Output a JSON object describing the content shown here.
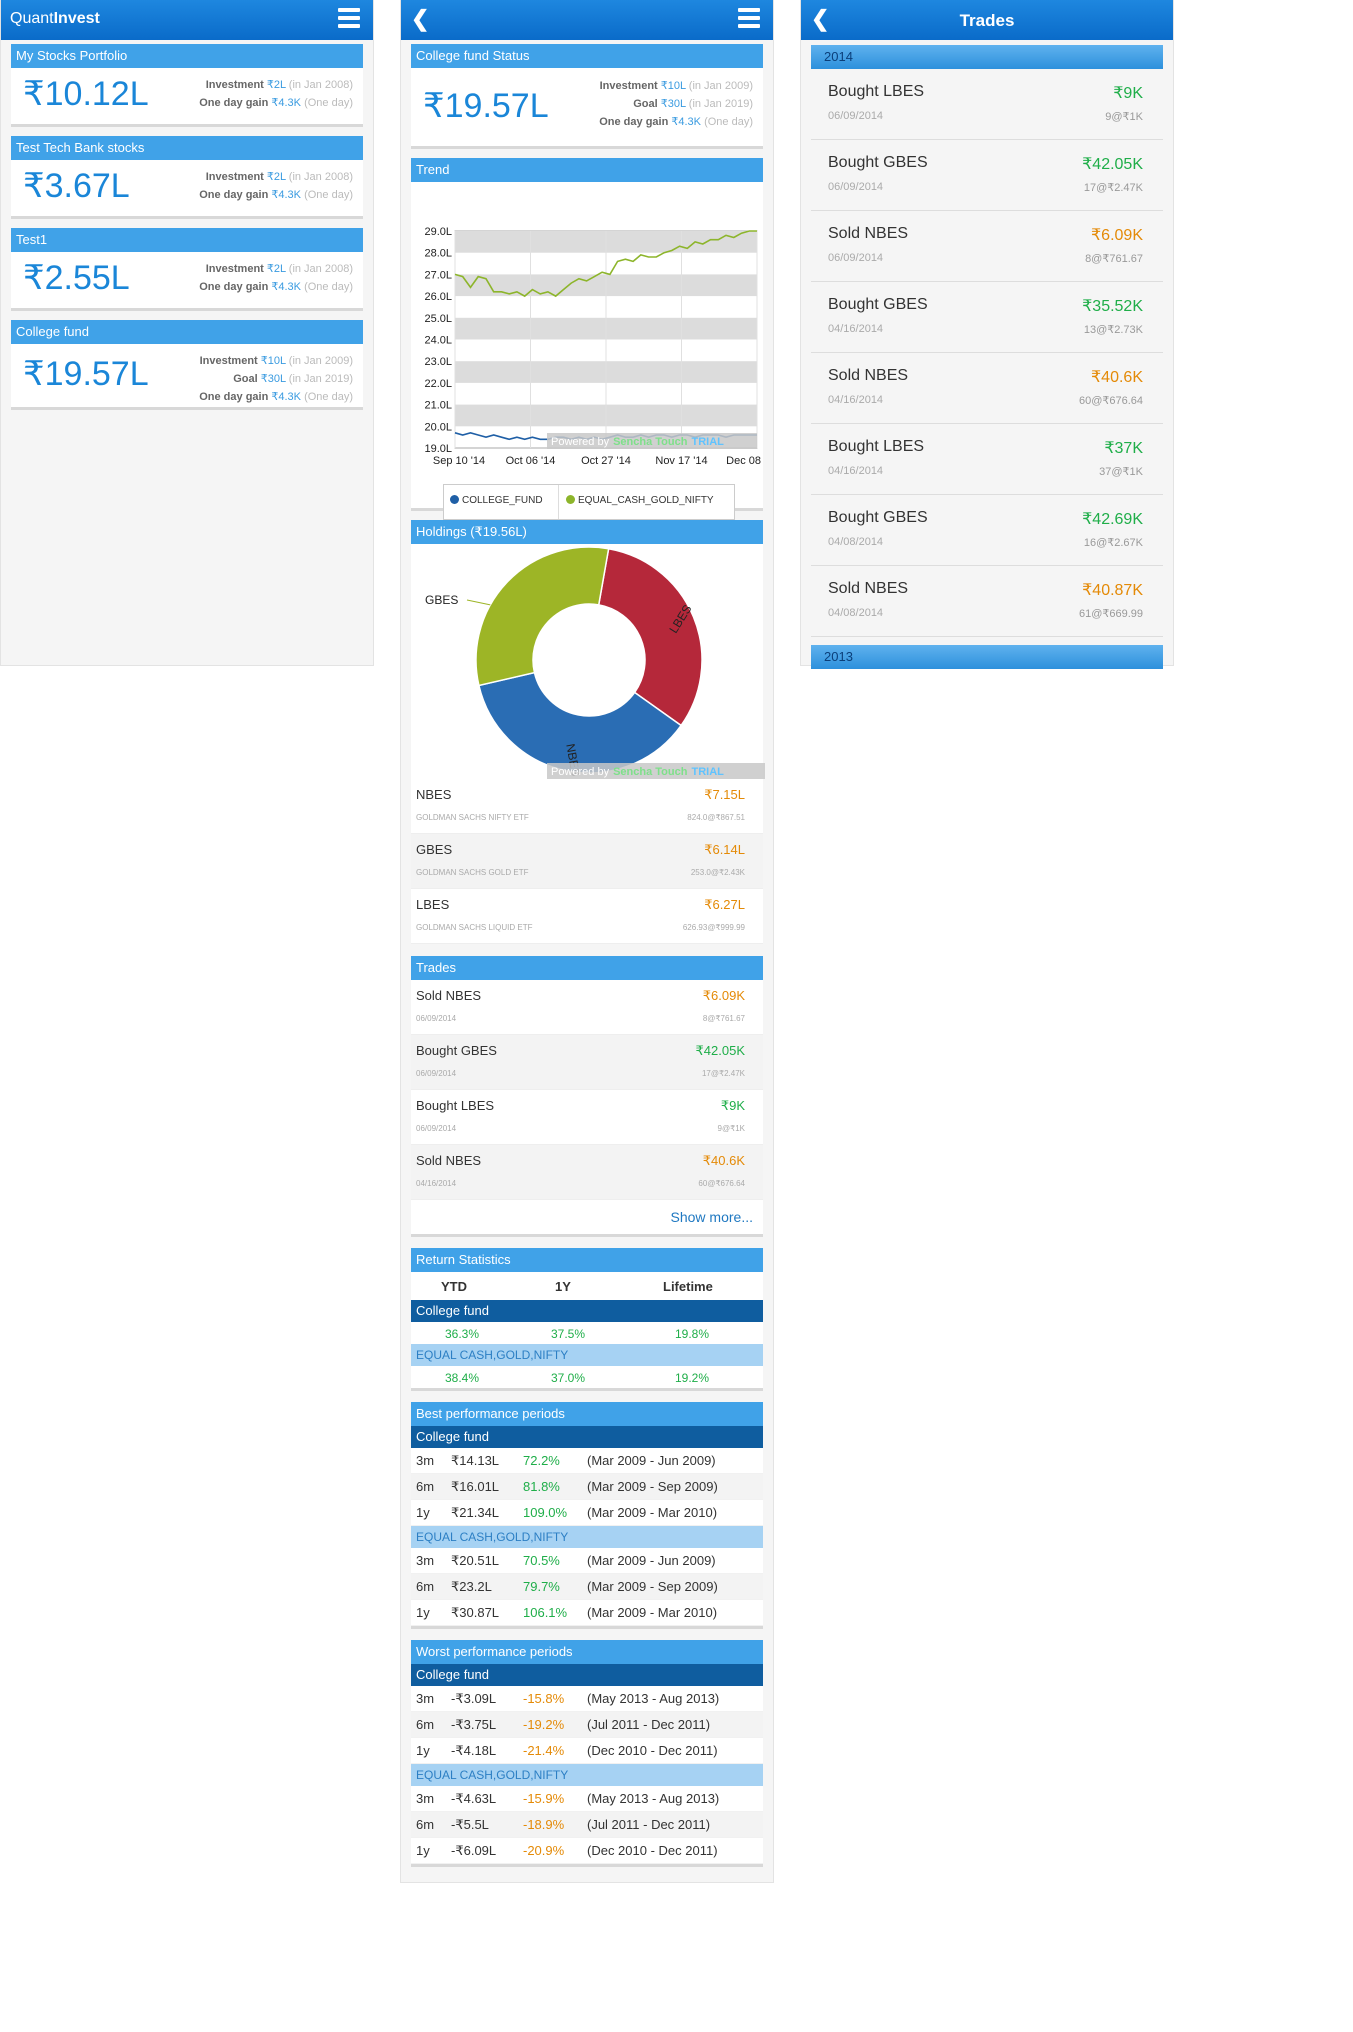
{
  "screen1": {
    "brand_plain": "Quant",
    "brand_bold": "Invest",
    "cards": [
      {
        "title": "My Stocks Portfolio",
        "value": "₹10.12L",
        "rows": [
          {
            "label": "Investment",
            "value": "₹2L",
            "note": "(in Jan 2008)"
          },
          {
            "label": "One day gain",
            "value": "₹4.3K",
            "note": "(One day)"
          }
        ]
      },
      {
        "title": "Test Tech Bank stocks",
        "value": "₹3.67L",
        "rows": [
          {
            "label": "Investment",
            "value": "₹2L",
            "note": "(in Jan 2008)"
          },
          {
            "label": "One day gain",
            "value": "₹4.3K",
            "note": "(One day)"
          }
        ]
      },
      {
        "title": "Test1",
        "value": "₹2.55L",
        "rows": [
          {
            "label": "Investment",
            "value": "₹2L",
            "note": "(in Jan 2008)"
          },
          {
            "label": "One day gain",
            "value": "₹4.3K",
            "note": "(One day)"
          }
        ]
      },
      {
        "title": "College fund",
        "value": "₹19.57L",
        "rows": [
          {
            "label": "Investment",
            "value": "₹10L",
            "note": "(in Jan 2009)"
          },
          {
            "label": "Goal",
            "value": "₹30L",
            "note": "(in Jan 2019)"
          },
          {
            "label": "One day gain",
            "value": "₹4.3K",
            "note": "(One day)"
          }
        ]
      }
    ]
  },
  "screen2": {
    "status": {
      "title": "College fund Status",
      "value": "₹19.57L",
      "rows": [
        {
          "label": "Investment",
          "value": "₹10L",
          "note": "(in Jan 2009)"
        },
        {
          "label": "Goal",
          "value": "₹30L",
          "note": "(in Jan 2019)"
        },
        {
          "label": "One day gain",
          "value": "₹4.3K",
          "note": "(One day)"
        }
      ]
    },
    "trend_title": "Trend",
    "powered_by": "Powered by",
    "sencha": "Sencha Touch",
    "trial": "TRIAL",
    "holdings_title": "Holdings (₹19.56L)",
    "holdings": [
      {
        "name": "NBES",
        "sub": "GOLDMAN SACHS NIFTY ETF",
        "amount": "₹7.15L",
        "qty": "824.0@₹867.51"
      },
      {
        "name": "GBES",
        "sub": "GOLDMAN SACHS GOLD ETF",
        "amount": "₹6.14L",
        "qty": "253.0@₹2.43K"
      },
      {
        "name": "LBES",
        "sub": "GOLDMAN SACHS LIQUID ETF",
        "amount": "₹6.27L",
        "qty": "626.93@₹999.99"
      }
    ],
    "trades_title": "Trades",
    "trades": [
      {
        "name": "Sold NBES",
        "date": "06/09/2014",
        "amount": "₹6.09K",
        "qty": "8@₹761.67",
        "kind": "orange"
      },
      {
        "name": "Bought GBES",
        "date": "06/09/2014",
        "amount": "₹42.05K",
        "qty": "17@₹2.47K",
        "kind": "green"
      },
      {
        "name": "Bought LBES",
        "date": "06/09/2014",
        "amount": "₹9K",
        "qty": "9@₹1K",
        "kind": "green"
      },
      {
        "name": "Sold NBES",
        "date": "04/16/2014",
        "amount": "₹40.6K",
        "qty": "60@₹676.64",
        "kind": "orange"
      }
    ],
    "show_more": "Show more...",
    "return_stats": {
      "title": "Return Statistics",
      "cols": [
        "YTD",
        "1Y",
        "Lifetime"
      ],
      "groups": [
        {
          "name": "College fund",
          "values": [
            "36.3%",
            "37.5%",
            "19.8%"
          ]
        },
        {
          "name": "EQUAL CASH,GOLD,NIFTY",
          "values": [
            "38.4%",
            "37.0%",
            "19.2%"
          ]
        }
      ]
    },
    "best": {
      "title": "Best performance periods",
      "groups": [
        {
          "name": "College fund",
          "rows": [
            {
              "p": "3m",
              "v": "₹14.13L",
              "pct": "72.2%",
              "range": "(Mar 2009 - Jun 2009)"
            },
            {
              "p": "6m",
              "v": "₹16.01L",
              "pct": "81.8%",
              "range": "(Mar 2009 - Sep 2009)"
            },
            {
              "p": "1y",
              "v": "₹21.34L",
              "pct": "109.0%",
              "range": "(Mar 2009 - Mar 2010)"
            }
          ]
        },
        {
          "name": "EQUAL CASH,GOLD,NIFTY",
          "rows": [
            {
              "p": "3m",
              "v": "₹20.51L",
              "pct": "70.5%",
              "range": "(Mar 2009 - Jun 2009)"
            },
            {
              "p": "6m",
              "v": "₹23.2L",
              "pct": "79.7%",
              "range": "(Mar 2009 - Sep 2009)"
            },
            {
              "p": "1y",
              "v": "₹30.87L",
              "pct": "106.1%",
              "range": "(Mar 2009 - Mar 2010)"
            }
          ]
        }
      ]
    },
    "worst": {
      "title": "Worst performance periods",
      "groups": [
        {
          "name": "College fund",
          "rows": [
            {
              "p": "3m",
              "v": "-₹3.09L",
              "pct": "-15.8%",
              "range": "(May 2013 - Aug 2013)"
            },
            {
              "p": "6m",
              "v": "-₹3.75L",
              "pct": "-19.2%",
              "range": "(Jul 2011 - Dec 2011)"
            },
            {
              "p": "1y",
              "v": "-₹4.18L",
              "pct": "-21.4%",
              "range": "(Dec 2010 - Dec 2011)"
            }
          ]
        },
        {
          "name": "EQUAL CASH,GOLD,NIFTY",
          "rows": [
            {
              "p": "3m",
              "v": "-₹4.63L",
              "pct": "-15.9%",
              "range": "(May 2013 - Aug 2013)"
            },
            {
              "p": "6m",
              "v": "-₹5.5L",
              "pct": "-18.9%",
              "range": "(Jul 2011 - Dec 2011)"
            },
            {
              "p": "1y",
              "v": "-₹6.09L",
              "pct": "-20.9%",
              "range": "(Dec 2010 - Dec 2011)"
            }
          ]
        }
      ]
    }
  },
  "screen3": {
    "title": "Trades",
    "years": [
      "2014",
      "2013"
    ],
    "trades": [
      {
        "name": "Bought LBES",
        "date": "06/09/2014",
        "amount": "₹9K",
        "qty": "9@₹1K",
        "kind": "green"
      },
      {
        "name": "Bought GBES",
        "date": "06/09/2014",
        "amount": "₹42.05K",
        "qty": "17@₹2.47K",
        "kind": "green"
      },
      {
        "name": "Sold NBES",
        "date": "06/09/2014",
        "amount": "₹6.09K",
        "qty": "8@₹761.67",
        "kind": "orange"
      },
      {
        "name": "Bought GBES",
        "date": "04/16/2014",
        "amount": "₹35.52K",
        "qty": "13@₹2.73K",
        "kind": "green"
      },
      {
        "name": "Sold NBES",
        "date": "04/16/2014",
        "amount": "₹40.6K",
        "qty": "60@₹676.64",
        "kind": "orange"
      },
      {
        "name": "Bought LBES",
        "date": "04/16/2014",
        "amount": "₹37K",
        "qty": "37@₹1K",
        "kind": "green"
      },
      {
        "name": "Bought GBES",
        "date": "04/08/2014",
        "amount": "₹42.69K",
        "qty": "16@₹2.67K",
        "kind": "green"
      },
      {
        "name": "Sold NBES",
        "date": "04/08/2014",
        "amount": "₹40.87K",
        "qty": "61@₹669.99",
        "kind": "orange"
      }
    ]
  },
  "colors": {
    "header": "#1e87df",
    "section": "#40a2e8",
    "dark": "#0f5d9f",
    "light": "#a6d2f3",
    "gain": "#1fae49",
    "loss": "#e48a07",
    "college": "#1f5fa6",
    "equal": "#8db52b",
    "lbes": "#b5283a",
    "nbes": "#2a6db4",
    "gbes": "#9db526"
  },
  "chart_data": [
    {
      "type": "line",
      "title": "Trend",
      "x_ticks": [
        "Sep 10 '14",
        "Oct 06 '14",
        "Oct 27 '14",
        "Nov 17 '14",
        "Dec 08"
      ],
      "y_ticks": [
        "19.0L",
        "20.0L",
        "21.0L",
        "22.0L",
        "23.0L",
        "24.0L",
        "25.0L",
        "26.0L",
        "27.0L",
        "28.0L",
        "29.0L"
      ],
      "ylim": [
        19,
        29
      ],
      "grid": true,
      "legend": "bottom",
      "series": [
        {
          "name": "COLLEGE_FUND",
          "color": "#1f5fa6",
          "values": [
            19.7,
            19.6,
            19.7,
            19.6,
            19.5,
            19.6,
            19.5,
            19.4,
            19.5,
            19.4,
            19.5,
            19.4,
            19.4,
            19.5,
            19.5,
            19.4,
            19.5,
            19.4,
            19.5,
            19.4,
            19.5,
            19.6,
            19.5,
            19.5,
            19.6,
            19.5,
            19.6,
            19.6,
            19.5,
            19.6,
            19.6,
            19.5,
            19.6,
            19.6,
            19.6,
            19.5,
            19.6,
            19.6,
            19.6,
            19.6
          ]
        },
        {
          "name": "EQUAL_CASH_GOLD_NIFTY",
          "color": "#8db52b",
          "values": [
            27.0,
            26.9,
            26.4,
            26.9,
            26.8,
            26.2,
            26.2,
            26.1,
            26.2,
            26.0,
            26.3,
            26.1,
            26.2,
            26.0,
            26.3,
            26.6,
            26.8,
            26.7,
            26.9,
            27.1,
            27.0,
            27.6,
            27.7,
            27.6,
            27.9,
            27.8,
            27.8,
            28.0,
            28.1,
            28.3,
            28.2,
            28.5,
            28.4,
            28.6,
            28.6,
            28.8,
            28.7,
            28.9,
            29.0,
            29.0
          ]
        }
      ]
    },
    {
      "type": "pie",
      "title": "Holdings (₹19.56L)",
      "categories": [
        "LBES",
        "NBES",
        "GBES"
      ],
      "values": [
        6.27,
        7.15,
        6.14
      ]
    }
  ]
}
